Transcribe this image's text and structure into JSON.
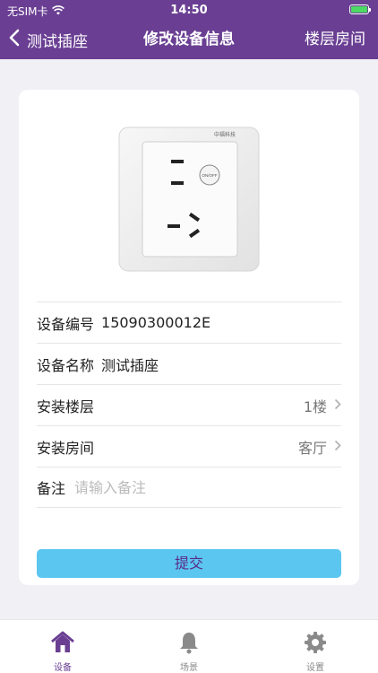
{
  "status_bar": {
    "carrier": "无SIM卡",
    "time": "14:50"
  },
  "nav": {
    "back_label": "测试插座",
    "title": "修改设备信息",
    "right_label": "楼层房间"
  },
  "device": {
    "image_icon": "wall-socket-image",
    "brand_text": "中福科技",
    "switch_text": "ON/OFF",
    "fields": {
      "code": {
        "label": "设备编号",
        "value": "15090300012E"
      },
      "name": {
        "label": "设备名称",
        "value": "测试插座"
      },
      "floor": {
        "label": "安装楼层",
        "value": "1楼"
      },
      "room": {
        "label": "安装房间",
        "value": "客厅"
      },
      "remark": {
        "label": "备注",
        "placeholder": "请输入备注"
      }
    },
    "submit_label": "提交"
  },
  "tabs": [
    {
      "label": "设备",
      "icon": "home-icon",
      "active": true
    },
    {
      "label": "场景",
      "icon": "bell-icon",
      "active": false
    },
    {
      "label": "设置",
      "icon": "gear-icon",
      "active": false
    }
  ],
  "colors": {
    "primary": "#6a3f93",
    "button": "#5bc6ef",
    "background": "#f1f0f5"
  }
}
